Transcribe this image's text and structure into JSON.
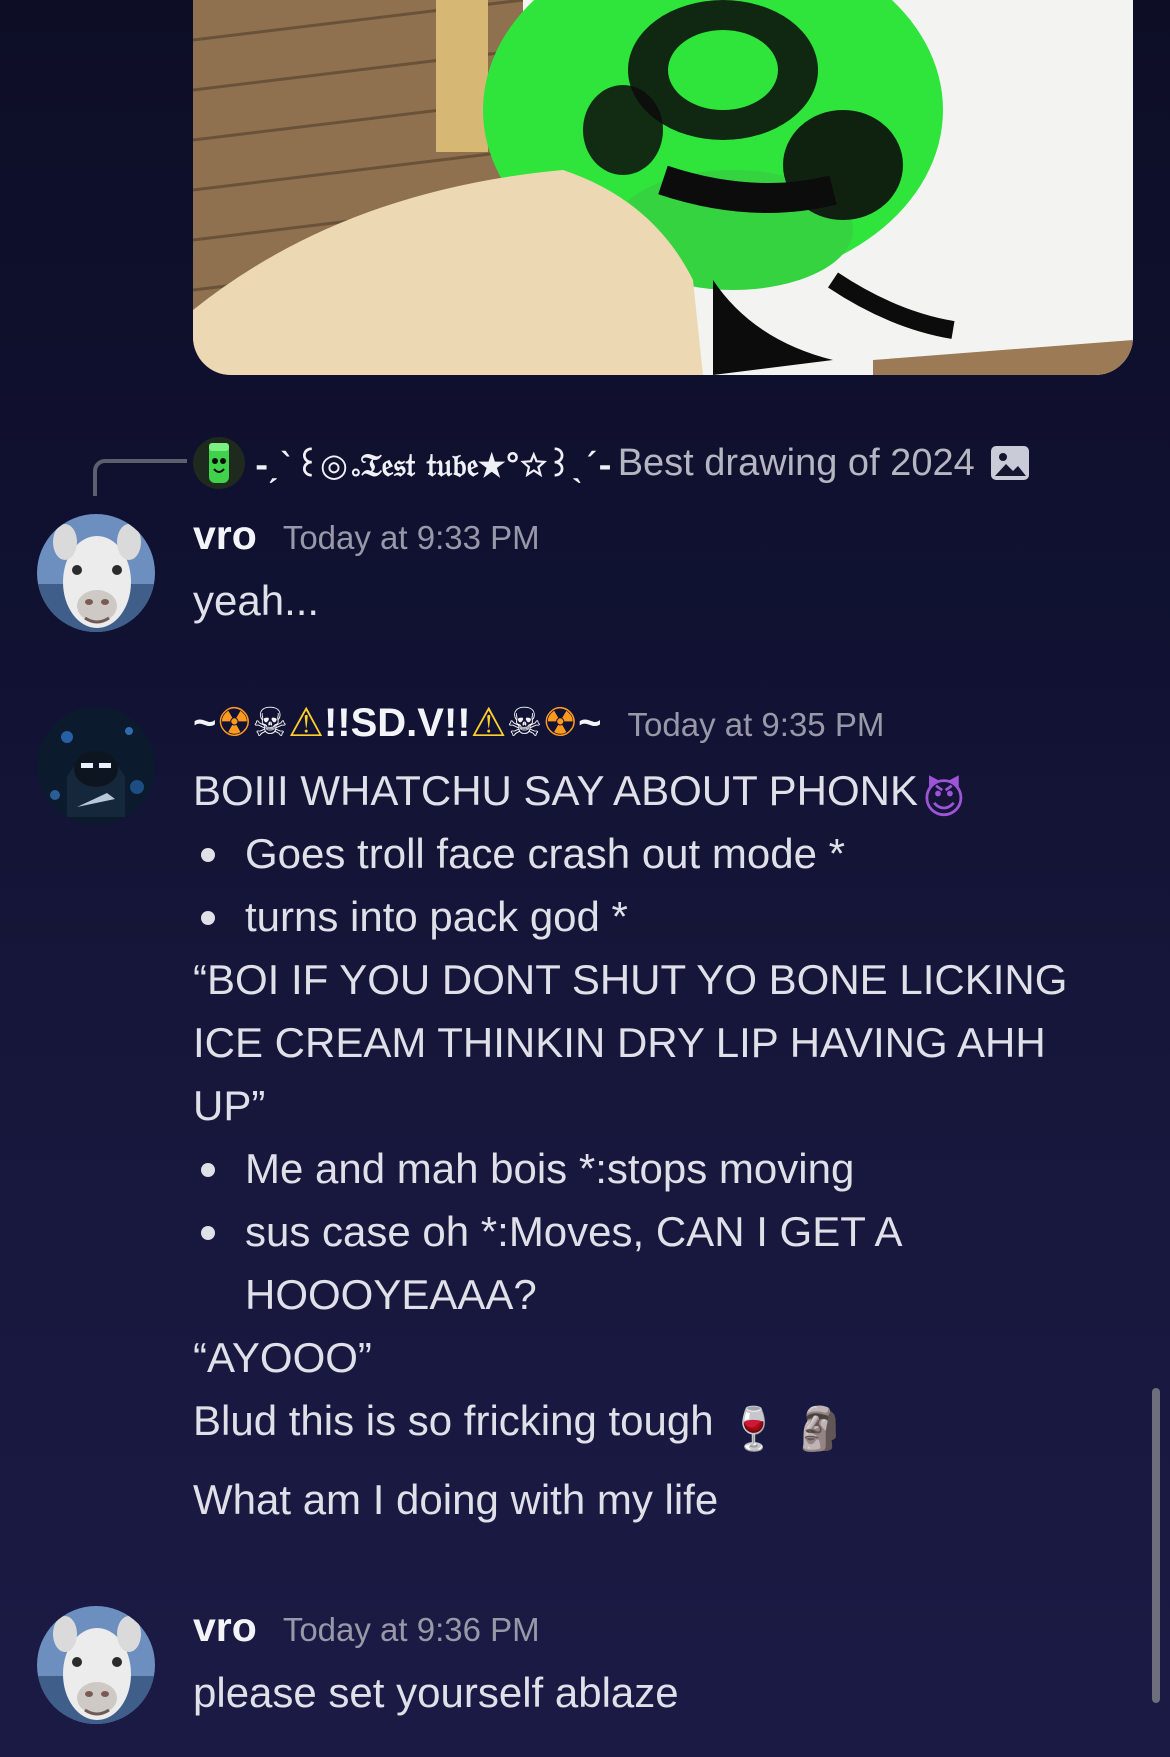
{
  "reply": {
    "author": "-ˏˋ꒰◎｡𝔗𝔢𝔰𝔱 𝔱𝔲𝔟𝔢★°☆꒱ˎˊ-",
    "text": "Best drawing of 2024",
    "icon": "image-icon"
  },
  "messages": [
    {
      "author": "vro",
      "time": "Today at 9:33 PM",
      "lines": [
        "yeah..."
      ]
    },
    {
      "author_prefix": "~",
      "author_core": "!!SD.V!!",
      "author_suffix": "~",
      "author_emoji_left": [
        "☢",
        "☠",
        "⚠"
      ],
      "author_emoji_right": [
        "⚠",
        "☠",
        "☢"
      ],
      "time": "Today at 9:35 PM",
      "line1": "BOIII WHATCHU SAY ABOUT PHONK",
      "line1_emoji": "😈",
      "bullets_a": [
        "Goes troll face crash out mode *",
        "turns into pack god *"
      ],
      "quote_lines": [
        "“BOI IF YOU DONT SHUT YO BONE LICKING",
        "ICE CREAM THINKIN DRY LIP HAVING AHH",
        "UP”"
      ],
      "bullets_b": [
        "Me and mah bois *:stops moving",
        "sus case oh *:Moves, CAN I GET A",
        "HOOOYEAAA?"
      ],
      "ayooo": "“AYOOO”",
      "tough_line": "Blud this is so fricking tough",
      "tough_emoji": [
        "🍷",
        "🗿"
      ],
      "life_line": "What am I doing with my life"
    },
    {
      "author": "vro",
      "time": "Today at 9:36 PM",
      "lines": [
        "please set yourself ablaze"
      ]
    }
  ]
}
